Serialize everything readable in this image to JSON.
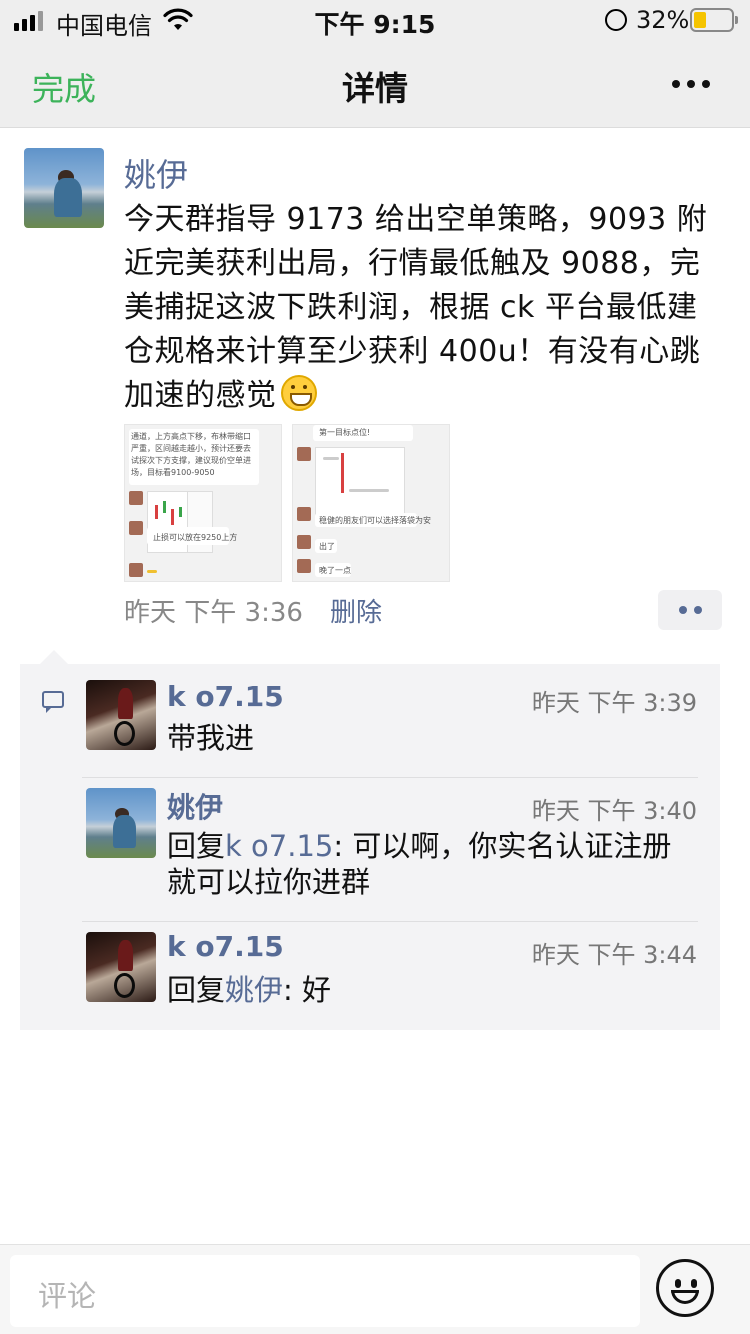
{
  "status_bar": {
    "carrier": "中国电信",
    "time": "下午 9:15",
    "battery_percent": "32%",
    "battery_level": 0.32,
    "icons": [
      "signal-icon",
      "wifi-icon",
      "orientation-lock-icon",
      "battery-icon"
    ]
  },
  "navbar": {
    "done_label": "完成",
    "title": "详情",
    "more_icon": "more-icon"
  },
  "post": {
    "author": "姚伊",
    "text": "今天群指导 9173 给出空单策略，9093 附近完美获利出局，行情最低触及 9088，完美捕捉这波下跌利润，根据 ck 平台最低建仓规格来计算至少获利 400u！有没有心跳加速的感觉",
    "emoji": "grinning-face-emoji",
    "images": [
      {
        "lines": [
          "通道，上方高点下移，布林带缩口",
          "严重，区间越走越小，预计还要去",
          "试探次下方支撑，建议现价空单进",
          "场，目标看9100-9050"
        ],
        "caption": "止损可以放在9250上方"
      },
      {
        "top_text": "第一目标点位!",
        "messages": [
          "稳健的朋友们可以选择落袋为安",
          "出了",
          "晚了一点"
        ]
      }
    ],
    "time": "昨天 下午 3:36",
    "delete_label": "删除"
  },
  "comments": [
    {
      "author": "k o7.15",
      "time": "昨天 下午 3:39",
      "text": "带我进"
    },
    {
      "author": "姚伊",
      "time": "昨天 下午 3:40",
      "reply_prefix": "回复",
      "reply_to": "k o7.15",
      "text": ": 可以啊，你实名认证注册就可以拉你进群"
    },
    {
      "author": "k o7.15",
      "time": "昨天 下午 3:44",
      "reply_prefix": "回复",
      "reply_to": "姚伊",
      "text": ": 好"
    }
  ],
  "input": {
    "placeholder": "评论",
    "emoji_button": "smiley-icon"
  },
  "colors": {
    "link": "#576b95",
    "done_green": "#3cb35a",
    "bar_bg": "#eeeeee",
    "comment_bg": "#f3f3f5"
  }
}
